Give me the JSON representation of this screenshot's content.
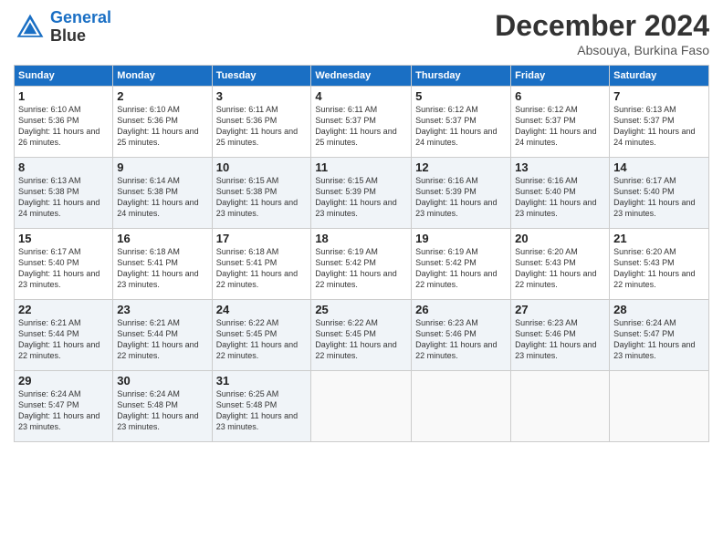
{
  "logo": {
    "line1": "General",
    "line2": "Blue"
  },
  "title": "December 2024",
  "location": "Absouya, Burkina Faso",
  "weekdays": [
    "Sunday",
    "Monday",
    "Tuesday",
    "Wednesday",
    "Thursday",
    "Friday",
    "Saturday"
  ],
  "weeks": [
    [
      {
        "day": "1",
        "sunrise": "6:10 AM",
        "sunset": "5:36 PM",
        "daylight": "11 hours and 26 minutes."
      },
      {
        "day": "2",
        "sunrise": "6:10 AM",
        "sunset": "5:36 PM",
        "daylight": "11 hours and 25 minutes."
      },
      {
        "day": "3",
        "sunrise": "6:11 AM",
        "sunset": "5:36 PM",
        "daylight": "11 hours and 25 minutes."
      },
      {
        "day": "4",
        "sunrise": "6:11 AM",
        "sunset": "5:37 PM",
        "daylight": "11 hours and 25 minutes."
      },
      {
        "day": "5",
        "sunrise": "6:12 AM",
        "sunset": "5:37 PM",
        "daylight": "11 hours and 24 minutes."
      },
      {
        "day": "6",
        "sunrise": "6:12 AM",
        "sunset": "5:37 PM",
        "daylight": "11 hours and 24 minutes."
      },
      {
        "day": "7",
        "sunrise": "6:13 AM",
        "sunset": "5:37 PM",
        "daylight": "11 hours and 24 minutes."
      }
    ],
    [
      {
        "day": "8",
        "sunrise": "6:13 AM",
        "sunset": "5:38 PM",
        "daylight": "11 hours and 24 minutes."
      },
      {
        "day": "9",
        "sunrise": "6:14 AM",
        "sunset": "5:38 PM",
        "daylight": "11 hours and 24 minutes."
      },
      {
        "day": "10",
        "sunrise": "6:15 AM",
        "sunset": "5:38 PM",
        "daylight": "11 hours and 23 minutes."
      },
      {
        "day": "11",
        "sunrise": "6:15 AM",
        "sunset": "5:39 PM",
        "daylight": "11 hours and 23 minutes."
      },
      {
        "day": "12",
        "sunrise": "6:16 AM",
        "sunset": "5:39 PM",
        "daylight": "11 hours and 23 minutes."
      },
      {
        "day": "13",
        "sunrise": "6:16 AM",
        "sunset": "5:40 PM",
        "daylight": "11 hours and 23 minutes."
      },
      {
        "day": "14",
        "sunrise": "6:17 AM",
        "sunset": "5:40 PM",
        "daylight": "11 hours and 23 minutes."
      }
    ],
    [
      {
        "day": "15",
        "sunrise": "6:17 AM",
        "sunset": "5:40 PM",
        "daylight": "11 hours and 23 minutes."
      },
      {
        "day": "16",
        "sunrise": "6:18 AM",
        "sunset": "5:41 PM",
        "daylight": "11 hours and 23 minutes."
      },
      {
        "day": "17",
        "sunrise": "6:18 AM",
        "sunset": "5:41 PM",
        "daylight": "11 hours and 22 minutes."
      },
      {
        "day": "18",
        "sunrise": "6:19 AM",
        "sunset": "5:42 PM",
        "daylight": "11 hours and 22 minutes."
      },
      {
        "day": "19",
        "sunrise": "6:19 AM",
        "sunset": "5:42 PM",
        "daylight": "11 hours and 22 minutes."
      },
      {
        "day": "20",
        "sunrise": "6:20 AM",
        "sunset": "5:43 PM",
        "daylight": "11 hours and 22 minutes."
      },
      {
        "day": "21",
        "sunrise": "6:20 AM",
        "sunset": "5:43 PM",
        "daylight": "11 hours and 22 minutes."
      }
    ],
    [
      {
        "day": "22",
        "sunrise": "6:21 AM",
        "sunset": "5:44 PM",
        "daylight": "11 hours and 22 minutes."
      },
      {
        "day": "23",
        "sunrise": "6:21 AM",
        "sunset": "5:44 PM",
        "daylight": "11 hours and 22 minutes."
      },
      {
        "day": "24",
        "sunrise": "6:22 AM",
        "sunset": "5:45 PM",
        "daylight": "11 hours and 22 minutes."
      },
      {
        "day": "25",
        "sunrise": "6:22 AM",
        "sunset": "5:45 PM",
        "daylight": "11 hours and 22 minutes."
      },
      {
        "day": "26",
        "sunrise": "6:23 AM",
        "sunset": "5:46 PM",
        "daylight": "11 hours and 22 minutes."
      },
      {
        "day": "27",
        "sunrise": "6:23 AM",
        "sunset": "5:46 PM",
        "daylight": "11 hours and 23 minutes."
      },
      {
        "day": "28",
        "sunrise": "6:24 AM",
        "sunset": "5:47 PM",
        "daylight": "11 hours and 23 minutes."
      }
    ],
    [
      {
        "day": "29",
        "sunrise": "6:24 AM",
        "sunset": "5:47 PM",
        "daylight": "11 hours and 23 minutes."
      },
      {
        "day": "30",
        "sunrise": "6:24 AM",
        "sunset": "5:48 PM",
        "daylight": "11 hours and 23 minutes."
      },
      {
        "day": "31",
        "sunrise": "6:25 AM",
        "sunset": "5:48 PM",
        "daylight": "11 hours and 23 minutes."
      },
      null,
      null,
      null,
      null
    ]
  ]
}
